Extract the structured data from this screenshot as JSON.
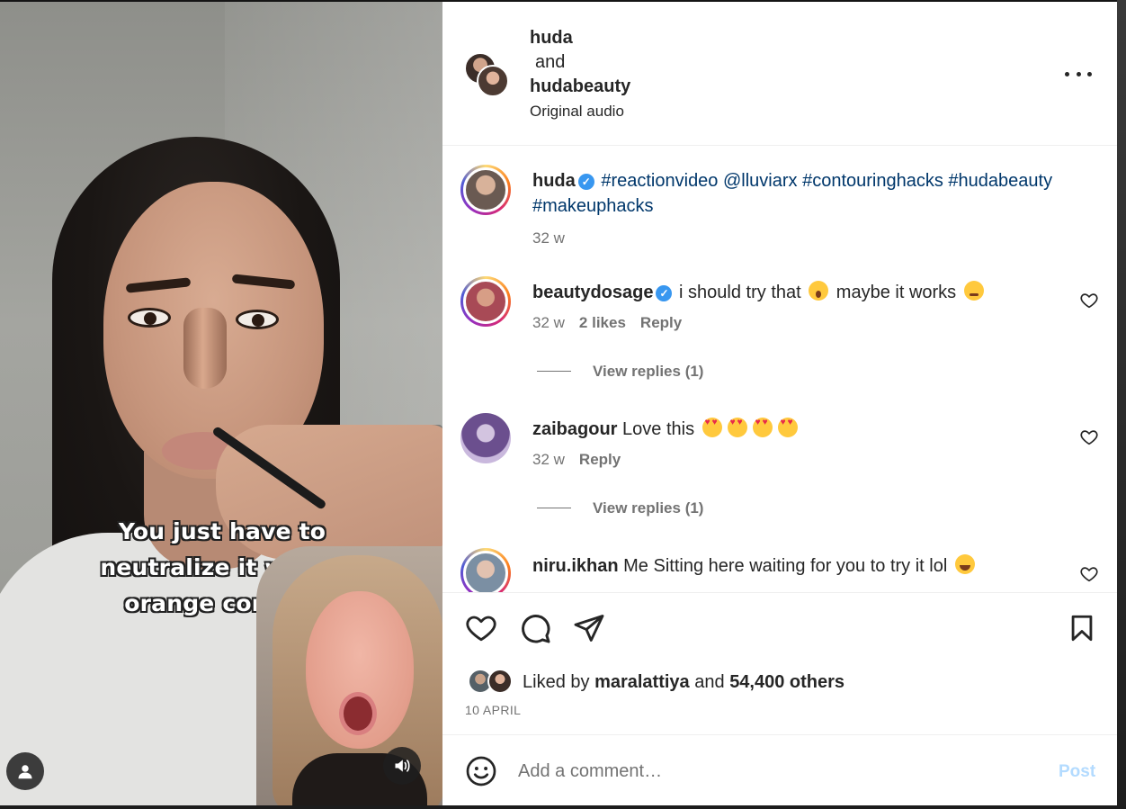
{
  "video": {
    "caption_lines": [
      "You just have to",
      "neutralize it with a",
      "orange conceal"
    ]
  },
  "header": {
    "user1": "huda",
    "and": "and",
    "user2": "hudabeauty",
    "audio": "Original audio"
  },
  "post_caption": {
    "username": "huda",
    "verified": true,
    "text": "#reactionvideo @lluviarx #contouringhacks #hudabeauty #makeuphacks",
    "time": "32 w"
  },
  "comments": [
    {
      "username": "beautydosage",
      "verified": true,
      "text_parts": [
        "i should try that",
        "maybe it works"
      ],
      "emojis": [
        "wow-emoji",
        "thinking-emoji"
      ],
      "time": "32 w",
      "likes": "2 likes",
      "reply": "Reply",
      "view_replies": "View replies (1)"
    },
    {
      "username": "zaibagour",
      "verified": false,
      "text": "Love this",
      "emojis": [
        "heart-eyes-emoji",
        "heart-eyes-emoji",
        "heart-eyes-emoji",
        "heart-eyes-emoji"
      ],
      "time": "32 w",
      "reply": "Reply",
      "view_replies": "View replies (1)"
    },
    {
      "username": "niru.ikhan",
      "verified": false,
      "text": "Me Sitting here waiting for you to try it lol",
      "emojis": [
        "laughing-emoji"
      ]
    }
  ],
  "likes": {
    "prefix": "Liked by",
    "user": "maralattiya",
    "and": "and",
    "others": "54,400 others"
  },
  "date": "10 APRIL",
  "add_comment": {
    "placeholder": "Add a comment…",
    "post_label": "Post"
  },
  "colors": {
    "link": "#00376b",
    "verified": "#3897f0",
    "muted": "#737373",
    "post_disabled": "#b3dbff"
  }
}
